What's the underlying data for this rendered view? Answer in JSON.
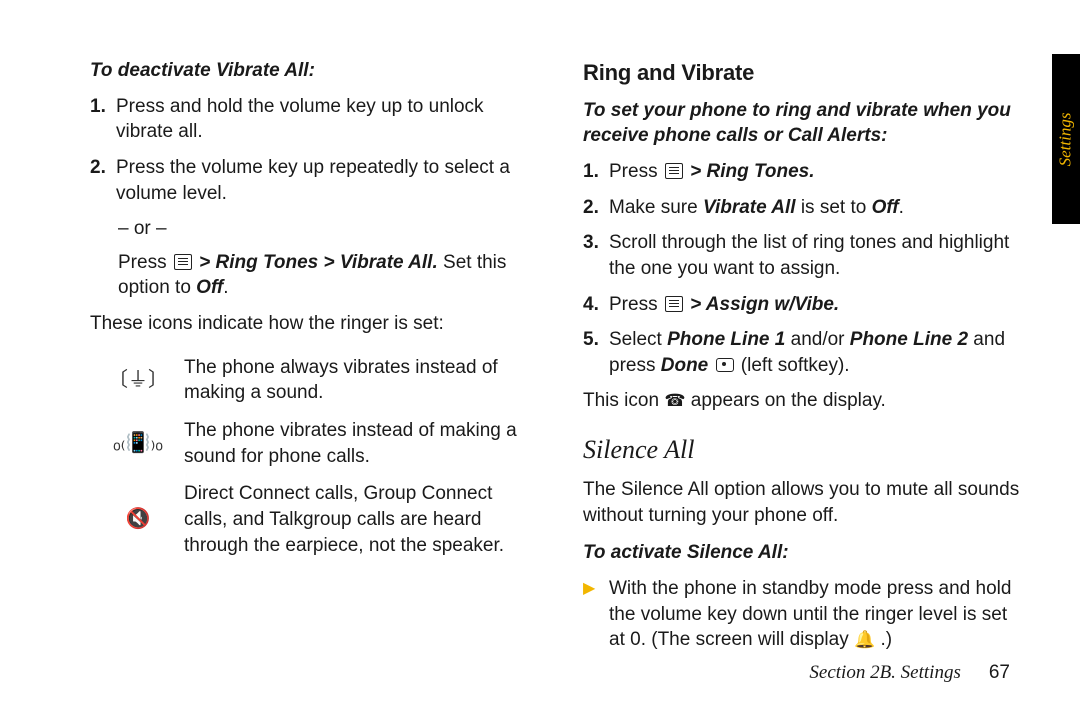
{
  "side_tab": "Settings",
  "footer": {
    "section": "Section 2B. Settings",
    "page": "67"
  },
  "left": {
    "subhead": "To deactivate Vibrate All:",
    "steps": [
      {
        "num": "1.",
        "text": "Press and hold the volume key up to unlock vibrate all."
      },
      {
        "num": "2.",
        "text": "Press the volume key up repeatedly to select a volume level."
      }
    ],
    "or": "– or –",
    "after_or_pre": "Press ",
    "after_or_path": "> Ring Tones > Vibrate All.",
    "after_or_post": " Set this option to ",
    "after_or_off": "Off",
    "icons_intro": "These icons indicate how the ringer is set:",
    "icon_rows": [
      {
        "glyph": "〔⏚〕",
        "text": "The phone always vibrates instead of making a sound."
      },
      {
        "glyph": "ₒ₍📳₎ₒ",
        "text": "The phone vibrates instead of making a sound for phone calls."
      },
      {
        "glyph": "🔇",
        "text": "Direct Connect calls, Group Connect calls, and Talkgroup calls are heard through the earpiece, not the speaker."
      }
    ]
  },
  "right": {
    "h_ring": "Ring and Vibrate",
    "sub_ring": "To set your phone to ring and vibrate when you receive phone calls or Call Alerts:",
    "steps": [
      {
        "num": "1.",
        "pre": "Press ",
        "path": "> Ring Tones."
      },
      {
        "num": "2.",
        "pre": "Make sure ",
        "b1": "Vibrate All",
        "mid": " is set to ",
        "b2": "Off",
        "post": "."
      },
      {
        "num": "3.",
        "text": "Scroll through the list of ring tones and highlight the one you want to assign."
      },
      {
        "num": "4.",
        "pre": "Press ",
        "path": " > Assign w/Vibe."
      },
      {
        "num": "5.",
        "pre": "Select ",
        "b1": "Phone Line 1",
        "mid": " and/or ",
        "b2": "Phone Line 2",
        "post1": " and press ",
        "b3": "Done",
        "post2": " (left softkey)."
      }
    ],
    "after_steps_pre": "This icon ",
    "after_steps_icon": "☎",
    "after_steps_post": " appears on the display.",
    "h_silence": "Silence All",
    "silence_para": "The Silence All option allows you to mute all sounds without turning your phone off.",
    "sub_silence": "To activate Silence All:",
    "silence_bullet_pre": "With the phone in standby mode press and hold the volume key down until the ringer level is set at 0. (The screen will display ",
    "silence_bullet_icon": "🔔",
    "silence_bullet_post": " .)",
    "arrow": "▶"
  }
}
